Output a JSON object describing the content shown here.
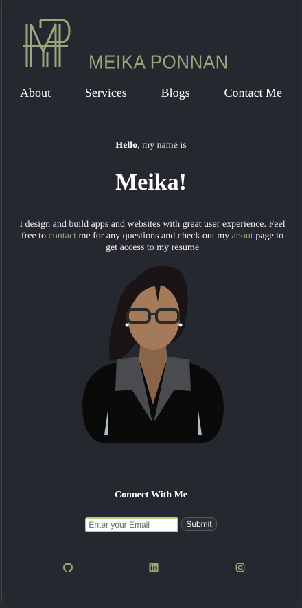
{
  "brand": {
    "name": "MEIKA PONNAN",
    "monogram": "MP",
    "color": "#9aa77a"
  },
  "nav": {
    "items": [
      {
        "label": "About"
      },
      {
        "label": "Services"
      },
      {
        "label": "Blogs"
      },
      {
        "label": "Contact Me"
      }
    ]
  },
  "hero": {
    "greeting_bold": "Hello",
    "greeting_rest": ", my name is",
    "headline": "Meika!",
    "intro_1": "I design and build apps and websites with great user experience. Feel free to ",
    "intro_link_1": "contact",
    "intro_2": " me for any questions and check out my ",
    "intro_link_2": "about",
    "intro_3": " page to get access to my resume"
  },
  "footer": {
    "connect_title": "Connect With Me",
    "email_placeholder": "Enter your Email",
    "submit_label": "Submit",
    "social_icons": [
      "github-icon",
      "linkedin-icon",
      "instagram-icon"
    ]
  },
  "colors": {
    "background": "#25282e",
    "accent": "#9aa77a",
    "input_border": "#b5d36a"
  }
}
